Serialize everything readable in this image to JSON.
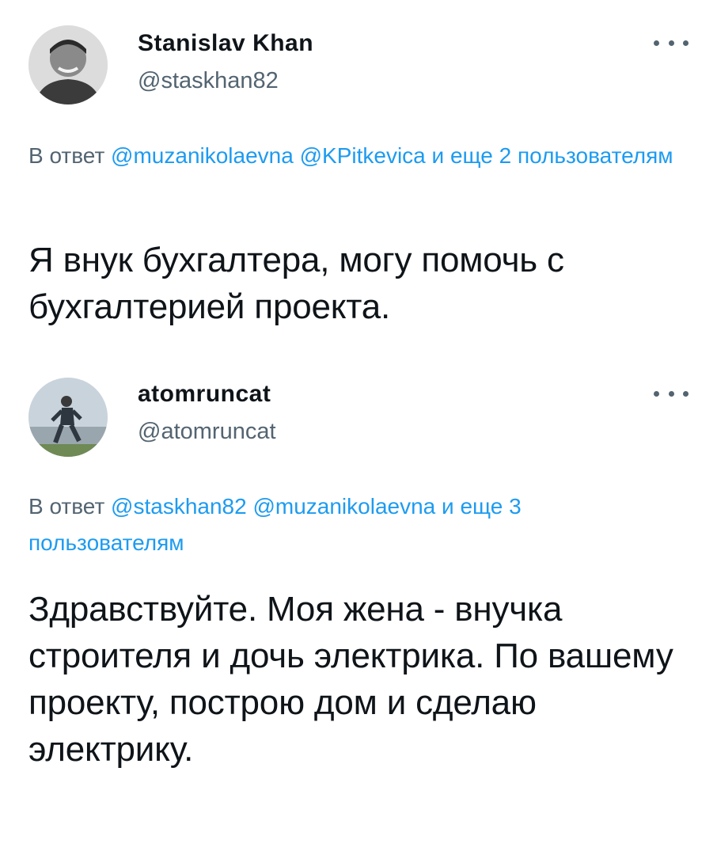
{
  "tweets": [
    {
      "author": {
        "display_name": "Stanislav Khan",
        "handle": "@staskhan82"
      },
      "reply": {
        "prefix": "В ответ",
        "mentions": [
          "@muzanikolaevna",
          "@KPitkevica"
        ],
        "others": "и еще 2 пользователям"
      },
      "text": "Я внук бухгалтера, могу помочь с бухгалтерией проекта."
    },
    {
      "author": {
        "display_name": "atomruncat",
        "handle": "@atomruncat"
      },
      "reply": {
        "prefix": "В ответ",
        "mentions": [
          "@staskhan82",
          "@muzanikolaevna"
        ],
        "others": "и еще 3 пользователям"
      },
      "text": "Здравствуйте. Моя жена - внучка строителя и дочь электрика. По вашему проекту, построю дом и сделаю электрику."
    }
  ],
  "icons": {
    "more": "more-horizontal-icon"
  },
  "colors": {
    "text": "#0f1419",
    "secondary": "#536471",
    "link": "#1d9bf0",
    "background": "#ffffff"
  }
}
